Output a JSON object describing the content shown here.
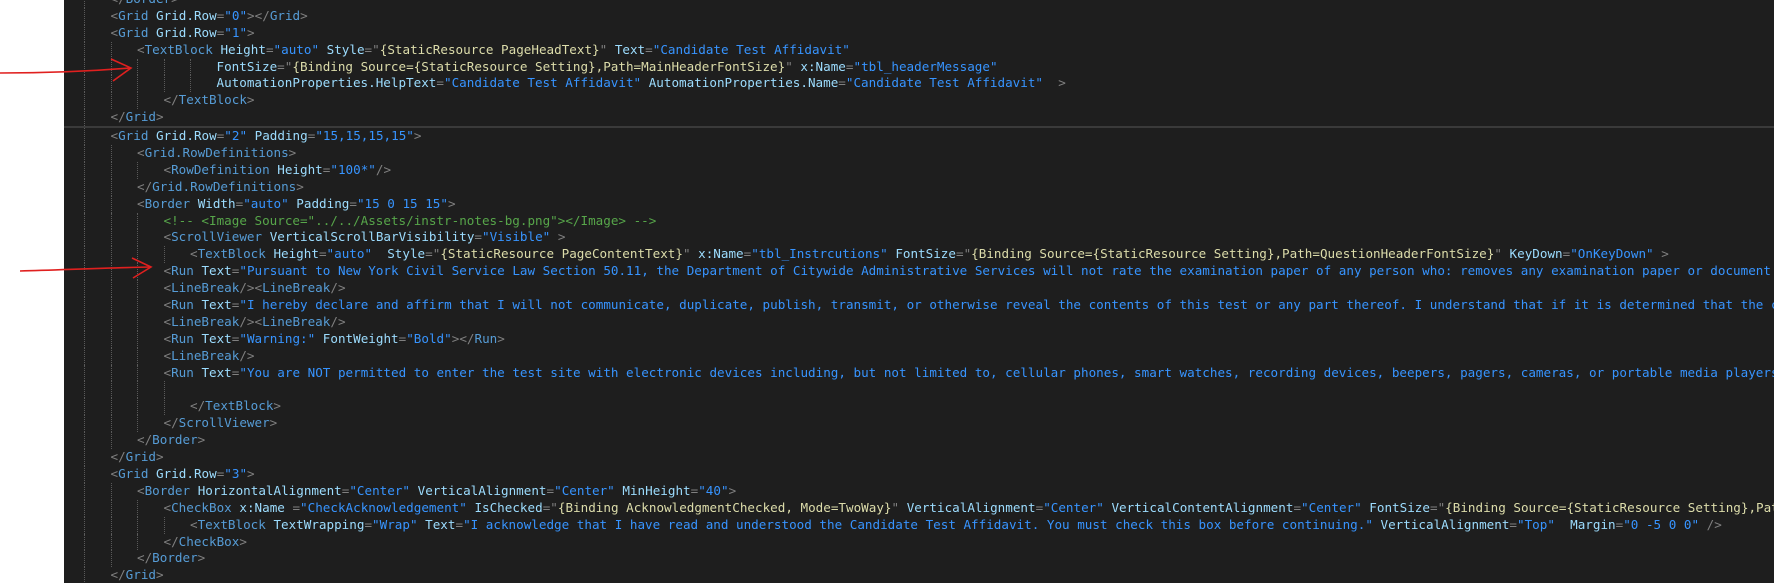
{
  "colors": {
    "editor_bg": "#1e1e1e",
    "tag": "#569cd6",
    "attribute": "#9cdcfe",
    "value": "#ce9178",
    "comment": "#57a64a",
    "arrow": "#e0201f"
  },
  "lines": [
    {
      "indent": 1,
      "html": "<span class='b'>&lt;/</span><span class='t'>Border</span><span class='b'>&gt;</span>"
    },
    {
      "indent": 1,
      "text_key": "l1"
    },
    {
      "indent": 1,
      "text_key": "l2"
    },
    {
      "indent": 2,
      "text_key": "l3"
    },
    {
      "indent": 5,
      "text_key": "l4"
    },
    {
      "indent": 5,
      "text_key": "l5"
    },
    {
      "indent": 3,
      "text_key": "l6"
    },
    {
      "indent": 1,
      "text_key": "l7",
      "sep": true
    },
    {
      "indent": 1,
      "text_key": "l8"
    },
    {
      "indent": 2,
      "text_key": "l9"
    },
    {
      "indent": 3,
      "text_key": "l10"
    },
    {
      "indent": 2,
      "text_key": "l11"
    },
    {
      "indent": 2,
      "text_key": "l12"
    },
    {
      "indent": 3,
      "text_key": "l13"
    },
    {
      "indent": 3,
      "text_key": "l14"
    },
    {
      "indent": 4,
      "text_key": "l15"
    },
    {
      "indent": 3,
      "text_key": "l16"
    },
    {
      "indent": 3,
      "text_key": "l17"
    },
    {
      "indent": 3,
      "text_key": "l18"
    },
    {
      "indent": 3,
      "text_key": "l19"
    },
    {
      "indent": 3,
      "text_key": "l20"
    },
    {
      "indent": 3,
      "text_key": "l21"
    },
    {
      "indent": 3,
      "text_key": "l22"
    },
    {
      "indent": 4,
      "text_key": "l23"
    },
    {
      "indent": 4,
      "text_key": "l24"
    },
    {
      "indent": 3,
      "text_key": "l25"
    },
    {
      "indent": 2,
      "text_key": "l26"
    },
    {
      "indent": 1,
      "text_key": "l27"
    },
    {
      "indent": 1,
      "text_key": "l28"
    },
    {
      "indent": 2,
      "text_key": "l29"
    },
    {
      "indent": 3,
      "text_key": "l30"
    },
    {
      "indent": 4,
      "text_key": "l31"
    },
    {
      "indent": 3,
      "text_key": "l32"
    },
    {
      "indent": 2,
      "text_key": "l33"
    },
    {
      "indent": 1,
      "text_key": "l34"
    }
  ],
  "text": {
    "l1": "<Grid Grid.Row=\"0\"></Grid>",
    "l2": "<Grid Grid.Row=\"1\">",
    "l3": "<TextBlock Height=\"auto\" Style=\"{StaticResource PageHeadText}\" Text=\"Candidate Test Affidavit\"",
    "l4": "FontSize=\"{Binding Source={StaticResource Setting},Path=MainHeaderFontSize}\" x:Name=\"tbl_headerMessage\"",
    "l5": "AutomationProperties.HelpText=\"Candidate Test Affidavit\" AutomationProperties.Name=\"Candidate Test Affidavit\"  >",
    "l6": "</TextBlock>",
    "l7": "</Grid>",
    "l8": "<Grid Grid.Row=\"2\" Padding=\"15,15,15,15\">",
    "l9": "<Grid.RowDefinitions>",
    "l10": "<RowDefinition Height=\"100*\"/>",
    "l11": "</Grid.RowDefinitions>",
    "l12": "<Border Width=\"auto\" Padding=\"15 0 15 15\">",
    "l13": "<!-- <Image Source=\"../../Assets/instr-notes-bg.png\"></Image> -->",
    "l14": "<ScrollViewer VerticalScrollBarVisibility=\"Visible\" >",
    "l15": "<TextBlock Height=\"auto\"  Style=\"{StaticResource PageContentText}\" x:Name=\"tbl_Instrcutions\" FontSize=\"{Binding Source={StaticResource Setting},Path=QuestionHeaderFontSize}\" KeyDown=\"OnKeyDown\" >",
    "l16": "<Run Text=\"Pursuant to New York Civil Service Law Section 50.11, the Department of Citywide Administrative Services will not rate the examination paper of any person who: removes any examination paper or document from",
    "l17": "<LineBreak/><LineBreak/>",
    "l18": "<Run Text=\"I hereby declare and affirm that I will not communicate, duplicate, publish, transmit, or otherwise reveal the contents of this test or any part thereof. I understand that if it is determined that the cont",
    "l19": "<LineBreak/><LineBreak/>",
    "l20": "<Run Text=\"Warning:\" FontWeight=\"Bold\"></Run>",
    "l21": "<LineBreak/>",
    "l22": "<Run Text=\"You are NOT permitted to enter the test site with electronic devices including, but not limited to, cellular phones, smart watches, recording devices, beepers, pagers, cameras, or portable media players.",
    "l23": "",
    "l24": "</TextBlock>",
    "l25": "</ScrollViewer>",
    "l26": "</Border>",
    "l27": "</Grid>",
    "l28": "<Grid Grid.Row=\"3\">",
    "l29": "<Border HorizontalAlignment=\"Center\" VerticalAlignment=\"Center\" MinHeight=\"40\">",
    "l30": "<CheckBox x:Name =\"CheckAcknowledgement\" IsChecked=\"{Binding AcknowledgmentChecked, Mode=TwoWay}\" VerticalAlignment=\"Center\" VerticalContentAlignment=\"Center\" FontSize=\"{Binding Source={StaticResource Setting},Path=",
    "l31": "<TextBlock TextWrapping=\"Wrap\" Text=\"I acknowledge that I have read and understood the Candidate Test Affidavit. You must check this box before continuing.\" VerticalAlignment=\"Top\"  Margin=\"0 -5 0 0\" />",
    "l32": "</CheckBox>",
    "l33": "</Border>",
    "l34": "</Grid>"
  }
}
